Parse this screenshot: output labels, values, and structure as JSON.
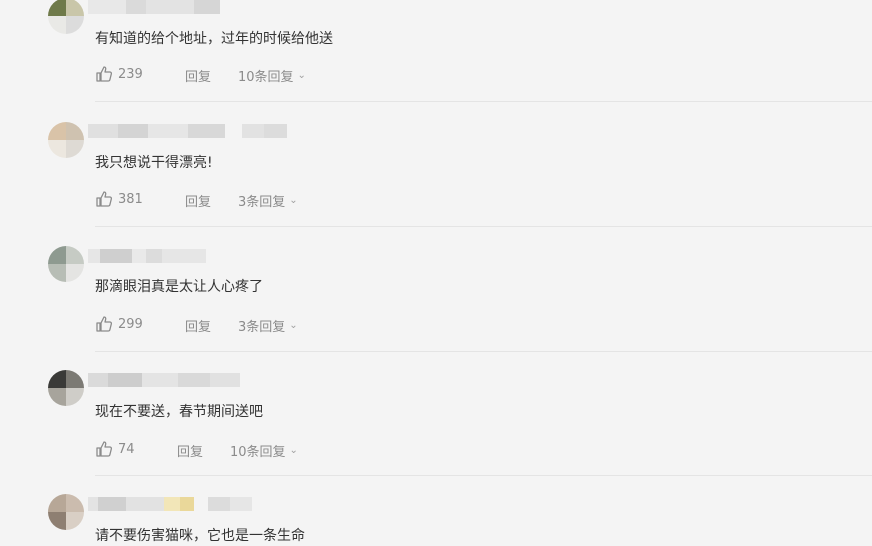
{
  "comments": [
    {
      "text": "有知道的给个地址，过年的时候给他送",
      "likes": "239",
      "reply_label": "回复",
      "replies_label": "10条回复"
    },
    {
      "text": "我只想说干得漂亮!",
      "likes": "381",
      "reply_label": "回复",
      "replies_label": "3条回复"
    },
    {
      "text": "那滴眼泪真是太让人心疼了",
      "likes": "299",
      "reply_label": "回复",
      "replies_label": "3条回复"
    },
    {
      "text": "现在不要送，春节期间送吧",
      "likes": "74",
      "reply_label": "回复",
      "replies_label": "10条回复"
    },
    {
      "text": "请不要伤害猫咪，它也是一条生命"
    }
  ],
  "icons": {
    "like": "thumbs-up-icon",
    "expand": "chevron-down-icon"
  },
  "colors": {
    "background": "#f4f4f4",
    "text": "#333333",
    "meta": "#8b8b8b",
    "divider": "#e4e4e4"
  }
}
